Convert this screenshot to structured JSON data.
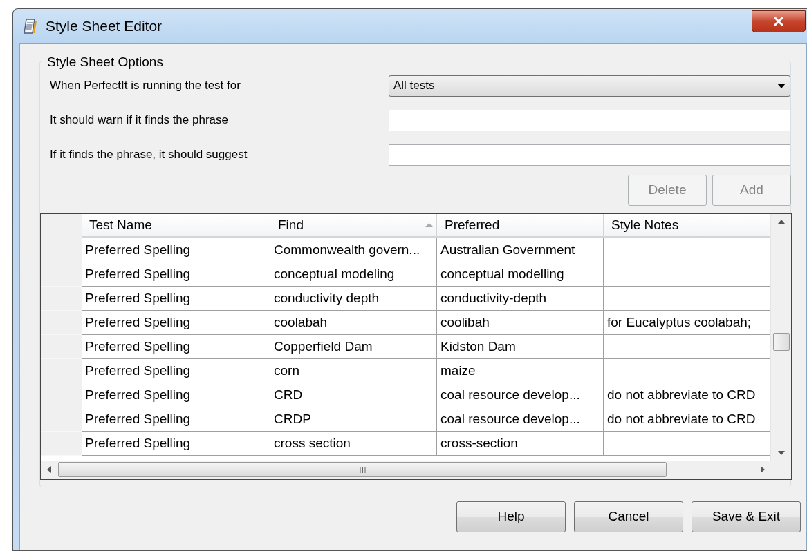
{
  "window": {
    "title": "Style Sheet Editor"
  },
  "options": {
    "legend": "Style Sheet Options",
    "fields": [
      {
        "kind": "dropdown",
        "label": "When PerfectIt is running the test for",
        "value": "All tests"
      },
      {
        "kind": "text",
        "label": "It should warn if it finds the phrase"
      },
      {
        "kind": "text",
        "label": "If it finds the phrase, it should suggest"
      }
    ],
    "buttons": [
      {
        "label": "Delete",
        "disabled": true
      },
      {
        "label": "Add",
        "disabled": true
      }
    ]
  },
  "table": {
    "columns": [
      {
        "label": "Test Name",
        "sorted": false
      },
      {
        "label": "Find",
        "sorted": true
      },
      {
        "label": "Preferred",
        "sorted": false
      },
      {
        "label": "Style Notes",
        "sorted": false
      }
    ],
    "rows": [
      [
        "Preferred Spelling",
        "Commonwealth govern...",
        "Australian Government",
        ""
      ],
      [
        "Preferred Spelling",
        "conceptual modeling",
        "conceptual modelling",
        ""
      ],
      [
        "Preferred Spelling",
        "conductivity depth",
        "conductivity-depth",
        ""
      ],
      [
        "Preferred Spelling",
        "coolabah",
        "coolibah",
        "for Eucalyptus coolabah;"
      ],
      [
        "Preferred Spelling",
        "Copperfield Dam",
        "Kidston Dam",
        ""
      ],
      [
        "Preferred Spelling",
        "corn",
        "maize",
        ""
      ],
      [
        "Preferred Spelling",
        "CRD",
        "coal resource develop...",
        "do not abbreviate to CRD"
      ],
      [
        "Preferred Spelling",
        "CRDP",
        "coal resource develop...",
        "do not abbreviate to CRD"
      ],
      [
        "Preferred Spelling",
        "cross section",
        "cross-section",
        ""
      ]
    ]
  },
  "footer_buttons": [
    "Help",
    "Cancel",
    "Save & Exit"
  ]
}
